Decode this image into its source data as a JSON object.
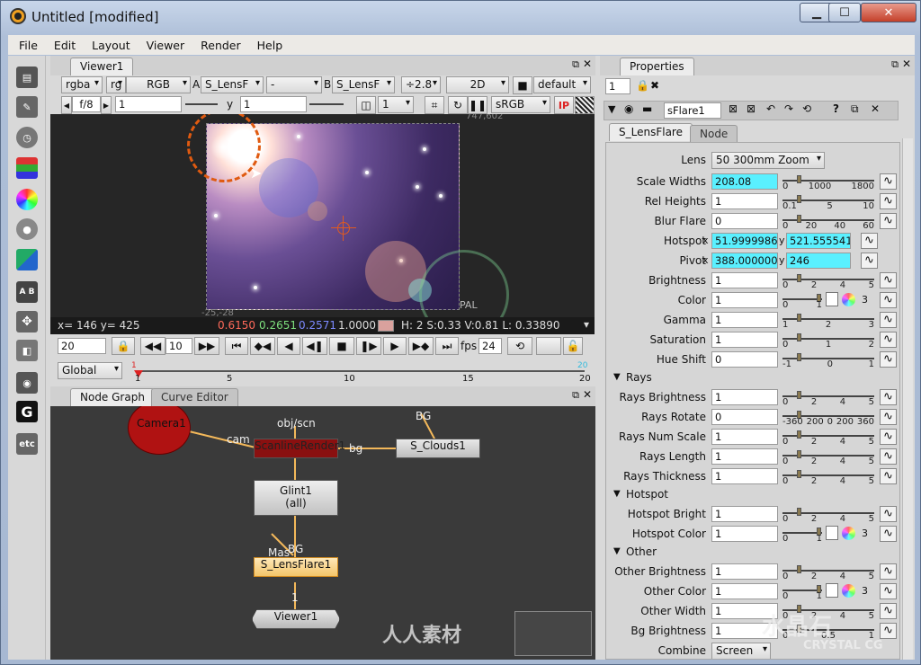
{
  "window": {
    "title": "Untitled [modified]",
    "minimize_label": "▁",
    "maximize_label": "☐",
    "close_label": "✕"
  },
  "menu": [
    "File",
    "Edit",
    "Layout",
    "Viewer",
    "Render",
    "Help"
  ],
  "left_toolbar": [
    "film-icon",
    "brush-icon",
    "clock-icon",
    "channels-icon",
    "color-wheel-icon",
    "circle-icon",
    "gradient-icon",
    "ab-icon",
    "move-icon",
    "cube-icon",
    "eye-icon",
    "g-icon",
    "etc-icon"
  ],
  "viewer": {
    "tab": "Viewer1",
    "row1": {
      "channels": "rgba",
      "channels2": "rg",
      "channels3": "RGB",
      "a_label": "A",
      "a_input": "S_LensF",
      "b_input_label": "-",
      "b_label": "B",
      "b_input": "S_LensF",
      "gain": "÷2.8",
      "mode": "2D",
      "lut": "default"
    },
    "row2": {
      "fstop": "f/8",
      "frame": "1",
      "y_label": "y",
      "y_value": "1",
      "proxy": "1",
      "colorspace": "sRGB",
      "ip": "IP"
    },
    "coord_topright": "747,602",
    "coord_bottomleft": "-25,-28",
    "format_label": "PAL",
    "status": {
      "xy": "x= 146 y= 425",
      "r": "0.6150",
      "g": "0.2651",
      "b": "0.2571",
      "a": "1.0000",
      "hsv": "H:  2 S:0.33 V:0.81  L: 0.33890"
    },
    "swatch_color": "#d9a19d"
  },
  "timeline": {
    "frame": "20",
    "step": "10",
    "fps_label": "fps",
    "fps": "24",
    "scope": "Global",
    "ticks": [
      "1",
      "5",
      "10",
      "15",
      "20"
    ],
    "start": "1",
    "end": "20"
  },
  "node_graph": {
    "tabs": [
      "Node Graph",
      "Curve Editor"
    ],
    "nodes": {
      "camera": "Camera1",
      "scanline": "ScanlineRender1",
      "clouds": "S_Clouds1",
      "glint": "Glint1",
      "glint_sub": "(all)",
      "lensflare": "S_LensFlare1",
      "viewer": "Viewer1"
    },
    "edge_labels": {
      "objscn": "obj/scn",
      "cam": "cam",
      "bg": "bg",
      "bg_top": "BG",
      "bg2": "BG",
      "mask": "Mas",
      "one": "1"
    }
  },
  "properties": {
    "tab": "Properties",
    "max_panels": "1",
    "node_name": "sFlare1",
    "tabs": [
      "S_LensFlare",
      "Node"
    ],
    "lens_label": "Lens",
    "lens_value": "50 300mm Zoom",
    "rows": [
      {
        "label": "Scale Widths",
        "value": "208.08",
        "cyan": true,
        "ticks": [
          "0",
          "1000",
          "1800"
        ]
      },
      {
        "label": "Rel Heights",
        "value": "1",
        "ticks": [
          "0.1",
          "5",
          "10"
        ]
      },
      {
        "label": "Blur Flare",
        "value": "0",
        "ticks": [
          "0",
          "20",
          "40",
          "60"
        ]
      },
      {
        "label": "Hotspot",
        "x": "51.9999986",
        "y": "521.555541",
        "xy": true
      },
      {
        "label": "Pivot",
        "x": "388.000000",
        "y": "246",
        "xy": true,
        "cyan": true
      },
      {
        "label": "Brightness",
        "value": "1",
        "ticks": [
          "0",
          "2",
          "4",
          "5"
        ]
      },
      {
        "label": "Color",
        "value": "1",
        "ticks": [
          "0",
          "1"
        ],
        "color": true,
        "num": "3"
      },
      {
        "label": "Gamma",
        "value": "1",
        "ticks": [
          "1",
          "2",
          "3"
        ]
      },
      {
        "label": "Saturation",
        "value": "1",
        "ticks": [
          "0",
          "1",
          "2"
        ]
      },
      {
        "label": "Hue Shift",
        "value": "0",
        "ticks": [
          "-1",
          "0",
          "1"
        ]
      }
    ],
    "sections": {
      "rays": {
        "title": "Rays",
        "rows": [
          {
            "label": "Rays Brightness",
            "value": "1",
            "ticks": [
              "0",
              "2",
              "4",
              "5"
            ]
          },
          {
            "label": "Rays Rotate",
            "value": "0",
            "ticks": [
              "-360",
              "200",
              "0",
              "200",
              "360"
            ]
          },
          {
            "label": "Rays Num Scale",
            "value": "1",
            "ticks": [
              "0",
              "2",
              "4",
              "5"
            ]
          },
          {
            "label": "Rays Length",
            "value": "1",
            "ticks": [
              "0",
              "2",
              "4",
              "5"
            ]
          },
          {
            "label": "Rays Thickness",
            "value": "1",
            "ticks": [
              "0",
              "2",
              "4",
              "5"
            ]
          }
        ]
      },
      "hotspot": {
        "title": "Hotspot",
        "rows": [
          {
            "label": "Hotspot Bright",
            "value": "1",
            "ticks": [
              "0",
              "2",
              "4",
              "5"
            ]
          },
          {
            "label": "Hotspot Color",
            "value": "1",
            "ticks": [
              "0",
              "1"
            ],
            "color": true,
            "num": "3"
          }
        ]
      },
      "other": {
        "title": "Other",
        "rows": [
          {
            "label": "Other Brightness",
            "value": "1",
            "ticks": [
              "0",
              "2",
              "4",
              "5"
            ]
          },
          {
            "label": "Other Color",
            "value": "1",
            "ticks": [
              "0",
              "1"
            ],
            "color": true,
            "num": "3"
          },
          {
            "label": "Other Width",
            "value": "1",
            "ticks": [
              "0",
              "2",
              "4",
              "5"
            ]
          },
          {
            "label": "Bg Brightness",
            "value": "1",
            "ticks": [
              "0",
              "0.5",
              "1"
            ]
          }
        ]
      }
    },
    "combine_label": "Combine",
    "combine_value": "Screen"
  },
  "watermark": {
    "brand": "人人素材",
    "text1": "水晶石",
    "text2": "CRYSTAL CG"
  }
}
